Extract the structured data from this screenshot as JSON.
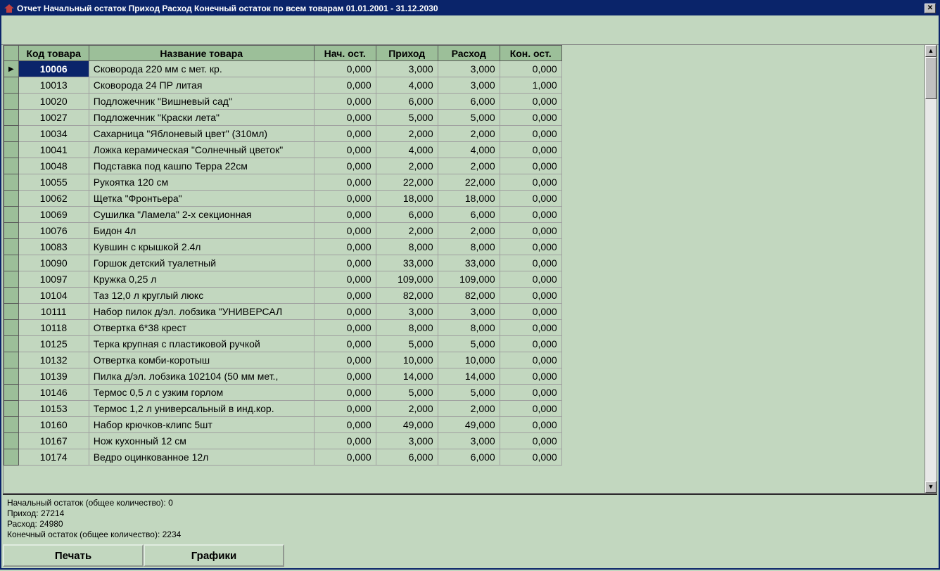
{
  "window": {
    "title": "Отчет Начальный остаток Приход Расход Конечный остаток по всем товарам   01.01.2001 - 31.12.2030",
    "close": "✕"
  },
  "grid": {
    "headers": {
      "selector": "",
      "code": "Код товара",
      "name": "Название товара",
      "start": "Нач. ост.",
      "in": "Приход",
      "out": "Расход",
      "end": "Кон. ост."
    },
    "rows": [
      {
        "code": "10006",
        "name": "Сковорода 220 мм с мет. кр.",
        "start": "0,000",
        "in": "3,000",
        "out": "3,000",
        "end": "0,000",
        "current": true
      },
      {
        "code": "10013",
        "name": "Сковорода 24 ПР литая",
        "start": "0,000",
        "in": "4,000",
        "out": "3,000",
        "end": "1,000"
      },
      {
        "code": "10020",
        "name": "Подложечник \"Вишневый сад\"",
        "start": "0,000",
        "in": "6,000",
        "out": "6,000",
        "end": "0,000"
      },
      {
        "code": "10027",
        "name": "Подложечник \"Краски лета\"",
        "start": "0,000",
        "in": "5,000",
        "out": "5,000",
        "end": "0,000"
      },
      {
        "code": "10034",
        "name": "Сахарница \"Яблоневый цвет\" (310мл)",
        "start": "0,000",
        "in": "2,000",
        "out": "2,000",
        "end": "0,000"
      },
      {
        "code": "10041",
        "name": "Ложка керамическая \"Солнечный цветок\"",
        "start": "0,000",
        "in": "4,000",
        "out": "4,000",
        "end": "0,000"
      },
      {
        "code": "10048",
        "name": "Подставка под кашпо Терра 22см",
        "start": "0,000",
        "in": "2,000",
        "out": "2,000",
        "end": "0,000"
      },
      {
        "code": "10055",
        "name": "Рукоятка 120 см",
        "start": "0,000",
        "in": "22,000",
        "out": "22,000",
        "end": "0,000"
      },
      {
        "code": "10062",
        "name": "Щетка \"Фронтьера\"",
        "start": "0,000",
        "in": "18,000",
        "out": "18,000",
        "end": "0,000"
      },
      {
        "code": "10069",
        "name": "Сушилка \"Ламела\" 2-х секционная",
        "start": "0,000",
        "in": "6,000",
        "out": "6,000",
        "end": "0,000"
      },
      {
        "code": "10076",
        "name": "Бидон 4л",
        "start": "0,000",
        "in": "2,000",
        "out": "2,000",
        "end": "0,000"
      },
      {
        "code": "10083",
        "name": "Кувшин с крышкой 2.4л",
        "start": "0,000",
        "in": "8,000",
        "out": "8,000",
        "end": "0,000"
      },
      {
        "code": "10090",
        "name": "Горшок детский туалетный",
        "start": "0,000",
        "in": "33,000",
        "out": "33,000",
        "end": "0,000"
      },
      {
        "code": "10097",
        "name": "Кружка 0,25 л",
        "start": "0,000",
        "in": "109,000",
        "out": "109,000",
        "end": "0,000"
      },
      {
        "code": "10104",
        "name": "Таз 12,0 л круглый люкс",
        "start": "0,000",
        "in": "82,000",
        "out": "82,000",
        "end": "0,000"
      },
      {
        "code": "10111",
        "name": "Набор пилок д/эл. лобзика \"УНИВЕРСАЛ",
        "start": "0,000",
        "in": "3,000",
        "out": "3,000",
        "end": "0,000"
      },
      {
        "code": "10118",
        "name": "Отвертка 6*38 крест",
        "start": "0,000",
        "in": "8,000",
        "out": "8,000",
        "end": "0,000"
      },
      {
        "code": "10125",
        "name": "Терка крупная с пластиковой ручкой",
        "start": "0,000",
        "in": "5,000",
        "out": "5,000",
        "end": "0,000"
      },
      {
        "code": "10132",
        "name": "Отвертка комби-коротыш",
        "start": "0,000",
        "in": "10,000",
        "out": "10,000",
        "end": "0,000"
      },
      {
        "code": "10139",
        "name": "Пилка д/эл. лобзика 102104 (50 мм мет.,",
        "start": "0,000",
        "in": "14,000",
        "out": "14,000",
        "end": "0,000"
      },
      {
        "code": "10146",
        "name": "Термос 0,5 л с узким горлом",
        "start": "0,000",
        "in": "5,000",
        "out": "5,000",
        "end": "0,000"
      },
      {
        "code": "10153",
        "name": "Термос 1,2 л универсальный в инд.кор.",
        "start": "0,000",
        "in": "2,000",
        "out": "2,000",
        "end": "0,000"
      },
      {
        "code": "10160",
        "name": "Набор крючков-клипс 5шт",
        "start": "0,000",
        "in": "49,000",
        "out": "49,000",
        "end": "0,000"
      },
      {
        "code": "10167",
        "name": "Нож кухонный 12 см",
        "start": "0,000",
        "in": "3,000",
        "out": "3,000",
        "end": "0,000"
      },
      {
        "code": "10174",
        "name": "Ведро оцинкованное 12л",
        "start": "0,000",
        "in": "6,000",
        "out": "6,000",
        "end": "0,000"
      }
    ]
  },
  "summary": {
    "line1": "Начальный остаток (общее количество): 0",
    "line2": "Приход: 27214",
    "line3": "Расход: 24980",
    "line4": "Конечный остаток (общее количество): 2234"
  },
  "buttons": {
    "print": "Печать",
    "charts": "Графики"
  },
  "scroll": {
    "up": "▲",
    "down": "▼"
  }
}
